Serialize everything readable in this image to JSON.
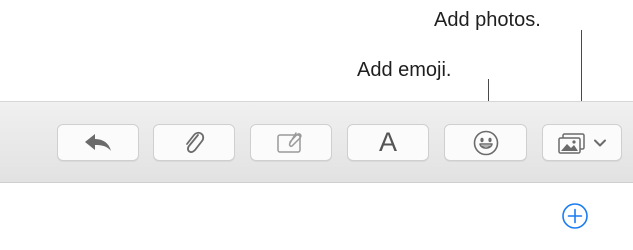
{
  "callouts": {
    "photos": "Add photos.",
    "emoji": "Add emoji."
  },
  "toolbar": {
    "format_label": "A",
    "buttons": [
      {
        "name": "reply-button",
        "icon": "reply-arrow-icon"
      },
      {
        "name": "attach-button",
        "icon": "paperclip-icon"
      },
      {
        "name": "markup-button",
        "icon": "markup-photo-icon"
      },
      {
        "name": "format-button",
        "icon": "letter-a"
      },
      {
        "name": "emoji-button",
        "icon": "smiley-icon"
      },
      {
        "name": "photo-browser-button",
        "icon": "photo-stack-icon"
      }
    ]
  },
  "colors": {
    "accent": "#1a7cf0",
    "icon_gray": "#6b6b6b",
    "toolbar_bg": "#e9e9e9"
  },
  "extra": {
    "add_icon": "plus-circle-icon"
  }
}
